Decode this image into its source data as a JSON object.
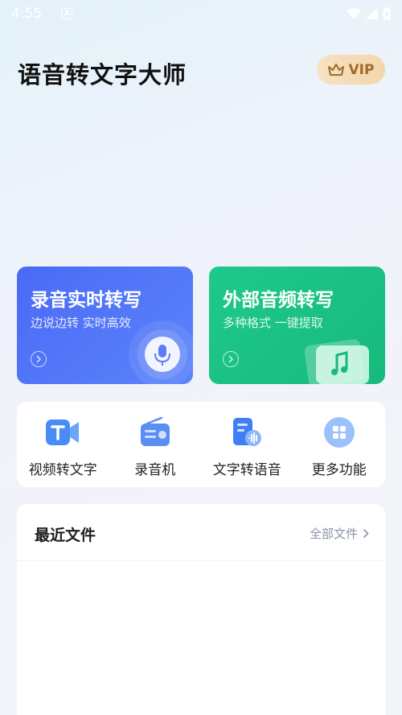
{
  "status_bar": {
    "time": "4:55",
    "notification_badge": "A"
  },
  "header": {
    "title": "语音转文字大师",
    "vip_label": "VIP"
  },
  "cards": [
    {
      "title": "录音实时转写",
      "subtitle": "边说边转 实时高效",
      "color": "#4f6ff6"
    },
    {
      "title": "外部音频转写",
      "subtitle": "多种格式 一键提取",
      "color": "#1bc286"
    }
  ],
  "functions": [
    {
      "label": "视频转文字",
      "icon": "video-text-icon"
    },
    {
      "label": "录音机",
      "icon": "radio-recorder-icon"
    },
    {
      "label": "文字转语音",
      "icon": "text-to-speech-icon"
    },
    {
      "label": "更多功能",
      "icon": "more-grid-icon"
    }
  ],
  "recent": {
    "title": "最近文件",
    "all_label": "全部文件"
  }
}
